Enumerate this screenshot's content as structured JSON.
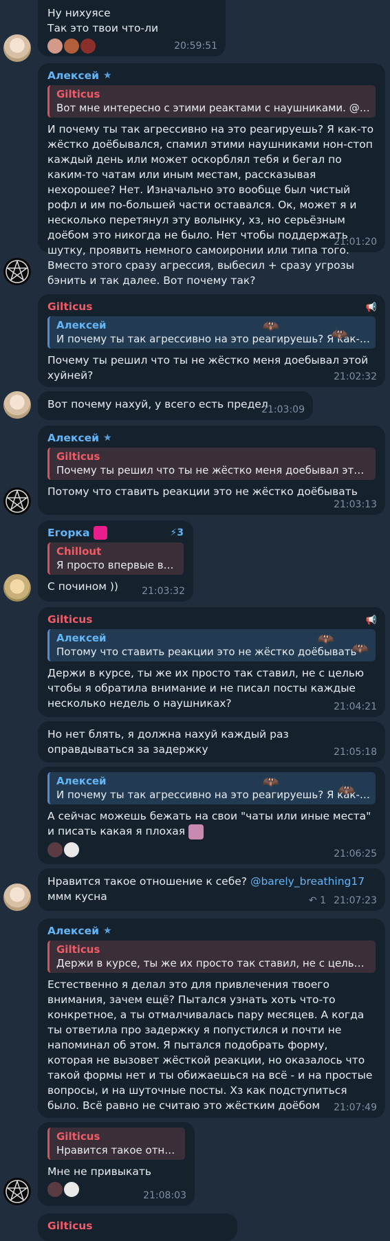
{
  "messages": {
    "m0": {
      "line1": "Ну нихуясе",
      "line2": "Так это твои что-ли",
      "time": "20:59:51"
    },
    "m1": {
      "sender": "Алексей",
      "quote_name": "Gilticus",
      "quote_text": "Вот мне интересно с этими реактами с наушниками. @b...",
      "text": "И почему ты так агрессивно на это реагируешь? Я как-то жёстко доёбывался, спамил этими наушниками нон-стоп каждый день или может оскорблял тебя и бегал по каким-то чатам или иным местам, рассказывая нехорошее? Нет. Изначально это вообще был чистый рофл и им по-большей части оставался. Ок, может я и несколько перетянул эту волынку, хз, но серьёзным доёбом это никогда не было. Нет чтобы поддержать шутку, проявить немного самоиронии или типа того. Вместо этого сразу агрессия, выбесил + сразу угрозы бэнить и так далее. Вот почему так?",
      "time": "21:01:20"
    },
    "m2": {
      "sender": "Gilticus",
      "quote_name": "Алексей",
      "quote_text": "И почему ты так агрессивно на это реагируешь? Я как-то...",
      "text": "Почему ты решил что ты не жёстко меня доебывал этой хуйней?",
      "time": "21:02:32"
    },
    "m3": {
      "text": "Вот почему нахуй, у всего есть предел",
      "time": "21:03:09"
    },
    "m4": {
      "sender": "Алексей",
      "quote_name": "Gilticus",
      "quote_text": "Почему ты решил что ты не жёстко меня доебывал этой ...",
      "text": "Потому что ставить реакции это не жёстко доёбывать",
      "time": "21:03:13"
    },
    "m5": {
      "sender": "Егорка",
      "boost": "3",
      "quote_name": "Chillout",
      "quote_text": "Я просто впервые ви...",
      "text": "С почином ))",
      "time": "21:03:32"
    },
    "m6": {
      "sender": "Gilticus",
      "quote_name": "Алексей",
      "quote_text": "Потому что ставить реакции это не жёстко доёбывать",
      "text": "Держи в курсе, ты же их просто так ставил, не с целью чтобы я обратила внимание и не писал посты каждые несколько недель о наушниках?",
      "time": "21:04:21"
    },
    "m7": {
      "text": "Но нет блять, я должна нахуй каждый раз оправдываться за задержку",
      "time": "21:05:18"
    },
    "m8": {
      "quote_name": "Алексей",
      "quote_text": "И почему ты так агрессивно на это реагируешь? Я как-то...",
      "text": "А сейчас можешь бежать на свои \"чаты или иные места\" и писать какая я плохая",
      "time": "21:06:25"
    },
    "m9": {
      "text": "Нравится такое отношение к себе?",
      "mention": "@barely_breathing17",
      "line2": "ммм кусна",
      "replies": "1",
      "time": "21:07:23"
    },
    "m10": {
      "sender": "Алексей",
      "quote_name": "Gilticus",
      "quote_text": "Держи в курсе, ты же их просто так ставил, не с целью чт...",
      "text": "Естественно я делал это для привлечения твоего внимания, зачем ещё? Пытался узнать хоть что-то конкретное, а ты отмалчивалась пару месяцев. А когда ты ответила про задержку я попустился и почти не напоминал об этом. Я пытался подобрать форму, которая не вызовет жёсткой реакции, но оказалось что такой формы нет и ты обижаешься на всё - и на простые вопросы, и на шуточные посты. Хз как подступиться было. Всё равно не считаю это жёстким доёбом",
      "time": "21:07:49"
    },
    "m11": {
      "quote_name": "Gilticus",
      "quote_text": "Нравится такое отно...",
      "text": "Мне не привыкать",
      "time": "21:08:03"
    },
    "m12": {
      "sender": "Gilticus"
    }
  },
  "icons": {
    "star": "star-icon",
    "channel": "megaphone-icon",
    "reply": "reply-arrow-icon"
  },
  "colors": {
    "background": "#1f2d3d",
    "bubble": "#15212d",
    "name_blue": "#64b5f6",
    "name_red": "#ef5b66"
  }
}
